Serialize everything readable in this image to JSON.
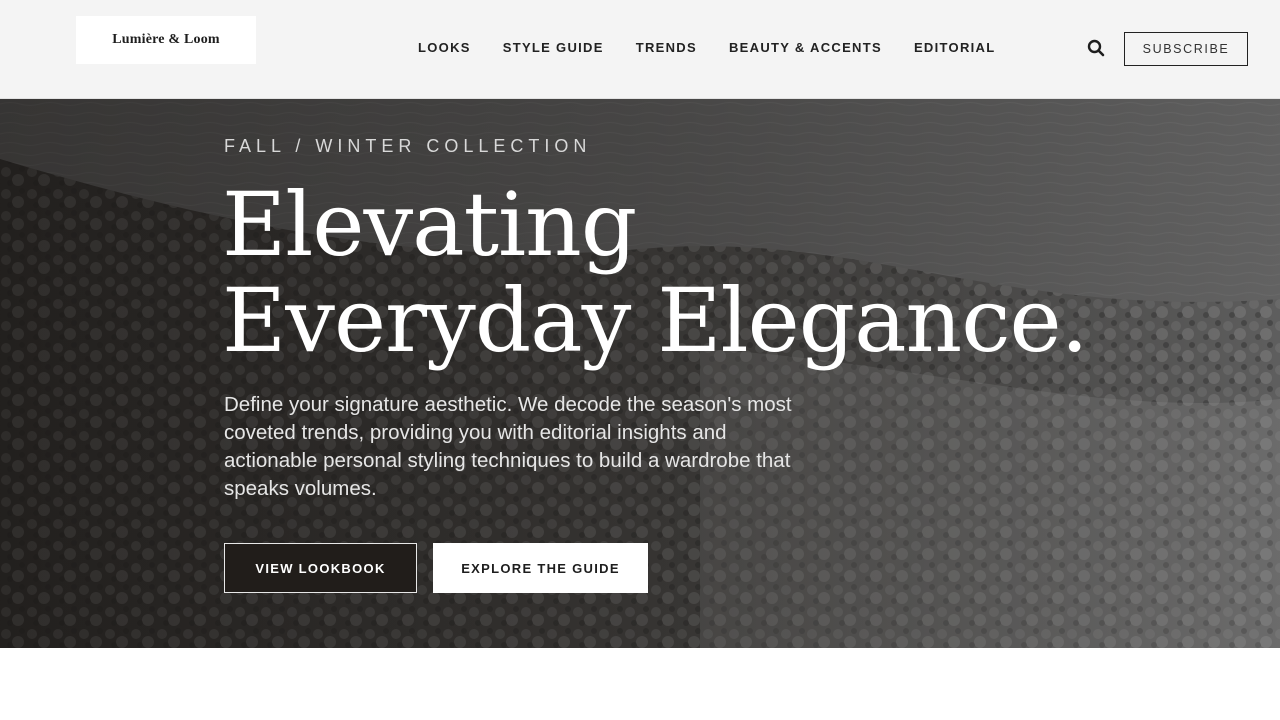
{
  "brand": {
    "logo_text": "Lumière & Loom"
  },
  "nav": {
    "items": [
      {
        "label": "LOOKS"
      },
      {
        "label": "STYLE GUIDE"
      },
      {
        "label": "TRENDS"
      },
      {
        "label": "BEAUTY & ACCENTS"
      },
      {
        "label": "EDITORIAL"
      }
    ],
    "search_icon": "search-icon",
    "subscribe_label": "SUBSCRIBE"
  },
  "hero": {
    "eyebrow": "FALL / WINTER COLLECTION",
    "headline_line1": "Elevating",
    "headline_line2": "Everyday Elegance.",
    "description": "Define your signature aesthetic. We decode the season's most coveted trends, providing you with editorial insights and actionable personal styling techniques to build a wardrobe that speaks volumes.",
    "primary_cta": "VIEW LOOKBOOK",
    "secondary_cta": "EXPLORE THE GUIDE",
    "background": "aerial-forest-and-lake-photo"
  },
  "colors": {
    "header_bg": "#f4f4f4",
    "text_dark": "#222222",
    "primary_button_bg": "#211d1a",
    "secondary_button_bg": "#ffffff",
    "hero_text": "#ffffff"
  }
}
